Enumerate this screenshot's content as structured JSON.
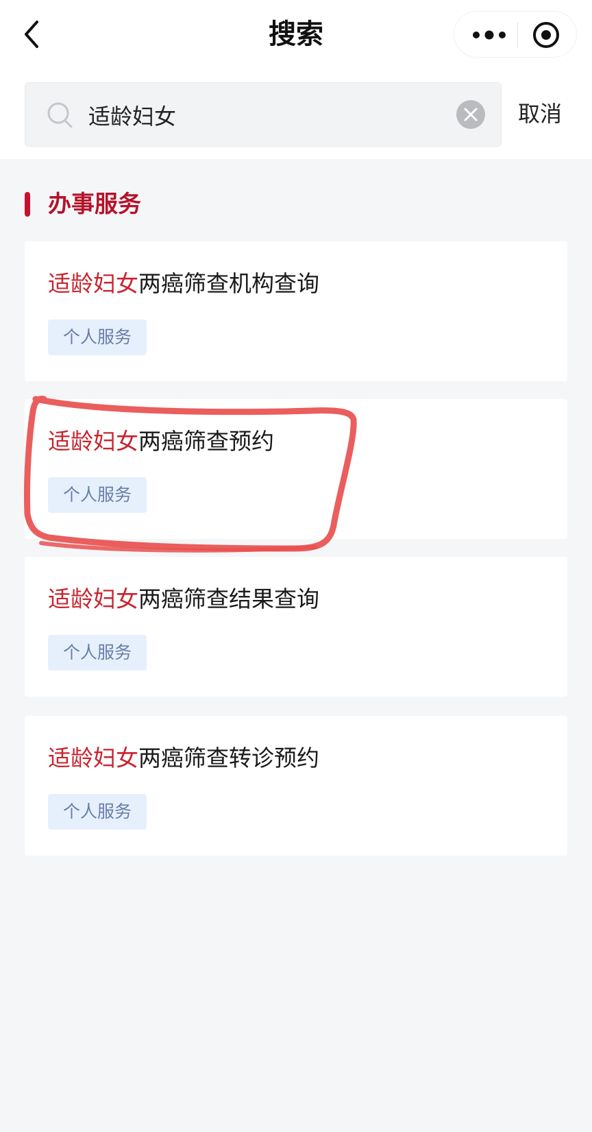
{
  "nav": {
    "title": "搜索",
    "back_icon": "chevron-left-icon",
    "more_icon": "more-dots-icon",
    "close_icon": "target-circle-icon"
  },
  "search": {
    "value": "适龄妇女",
    "placeholder": "",
    "cancel_label": "取消"
  },
  "section": {
    "title": "办事服务",
    "accent_color": "#c8102e"
  },
  "results": [
    {
      "highlight": "适龄妇女",
      "rest": "两癌筛查机构查询",
      "tag": "个人服务"
    },
    {
      "highlight": "适龄妇女",
      "rest": "两癌筛查预约",
      "tag": "个人服务"
    },
    {
      "highlight": "适龄妇女",
      "rest": "两癌筛查结果查询",
      "tag": "个人服务"
    },
    {
      "highlight": "适龄妇女",
      "rest": "两癌筛查转诊预约",
      "tag": "个人服务"
    }
  ],
  "colors": {
    "highlight": "#c8242f",
    "tag_bg": "#e6f0fd",
    "tag_text": "#6a7da6",
    "annotation": "#e8504f"
  }
}
